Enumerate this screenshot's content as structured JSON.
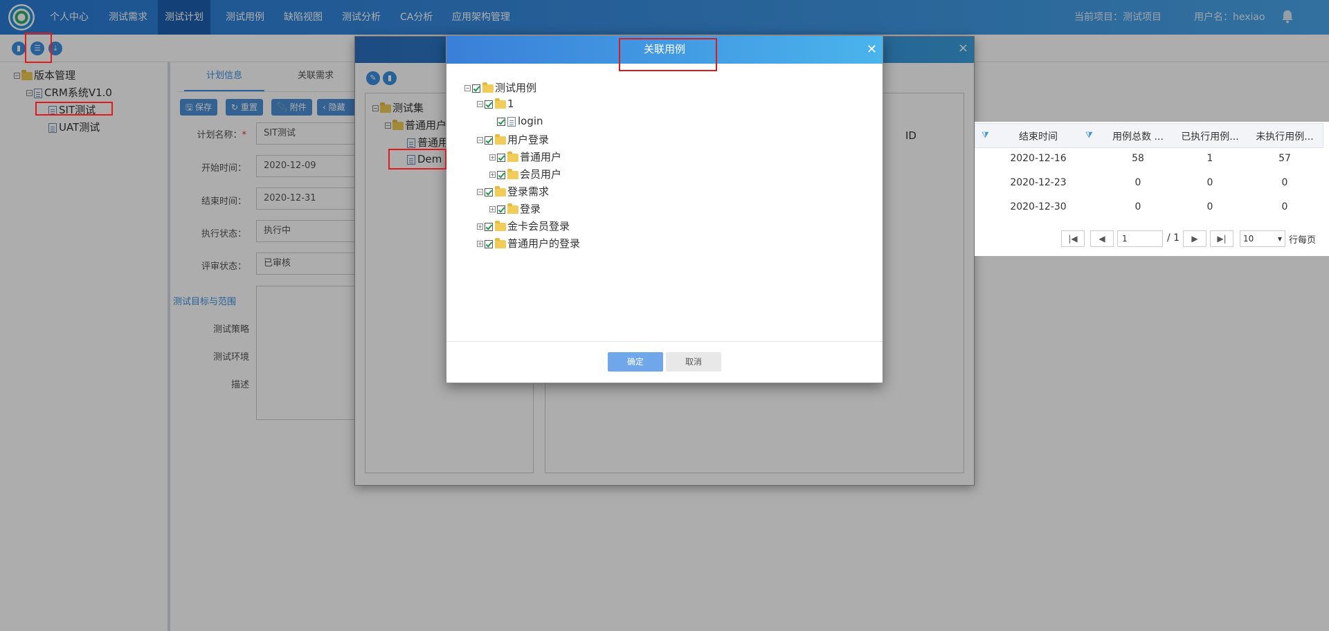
{
  "nav": {
    "items": [
      "个人中心",
      "测试需求",
      "测试计划",
      "测试用例",
      "缺陷视图",
      "测试分析",
      "CA分析",
      "应用架构管理"
    ],
    "active_index": 2,
    "current_project": "当前项目：测试项目",
    "username": "用户名：hexiao"
  },
  "left_tree": {
    "root": "版本管理",
    "version": "CRM系统V1.0",
    "plans": [
      "SIT测试",
      "UAT测试"
    ]
  },
  "tabs": [
    "计划信息",
    "关联需求"
  ],
  "buttons": {
    "save": "保存",
    "reset": "重置",
    "attach": "附件",
    "back": "隐藏"
  },
  "form": {
    "plan_name_label": "计划名称：",
    "plan_name": "SIT测试",
    "start_label": "开始时间：",
    "start": "2020-12-09",
    "end_label": "结束时间：",
    "end": "2020-12-31",
    "exec_label": "执行状态：",
    "exec": "执行中",
    "review_label": "评审状态：",
    "review": "已审核",
    "goal_label": "测试目标与范围",
    "strategy_label": "测试策略",
    "env_label": "测试环境",
    "desc_label": "描述"
  },
  "bg_dialog": {
    "tree_root": "测试集",
    "folder": "普通用户",
    "doc1": "普通用",
    "doc2": "Dem",
    "id_col": "ID"
  },
  "grid": {
    "headers": [
      "结束时间",
      "用例总数 ...",
      "已执行用例...",
      "未执行用例..."
    ],
    "rows": [
      [
        "2020-12-16",
        "58",
        "1",
        "57"
      ],
      [
        "2020-12-23",
        "0",
        "0",
        "0"
      ],
      [
        "2020-12-30",
        "0",
        "0",
        "0"
      ]
    ],
    "page_value": "1",
    "page_total": "/ 1",
    "page_size": "10",
    "per_page_label": "行每页"
  },
  "modal": {
    "title": "关联用例",
    "tree": [
      {
        "label": "测试用例",
        "type": "folder",
        "toggle": "−",
        "level": 0
      },
      {
        "label": "1",
        "type": "folder",
        "toggle": "−",
        "level": 1
      },
      {
        "label": "login",
        "type": "doc",
        "toggle": "",
        "level": 2
      },
      {
        "label": "用户登录",
        "type": "folder",
        "toggle": "−",
        "level": 1
      },
      {
        "label": "普通用户",
        "type": "folder",
        "toggle": "+",
        "level": 2
      },
      {
        "label": "会员用户",
        "type": "folder",
        "toggle": "+",
        "level": 2
      },
      {
        "label": "登录需求",
        "type": "folder",
        "toggle": "−",
        "level": 1
      },
      {
        "label": "登录",
        "type": "folder",
        "toggle": "+",
        "level": 2
      },
      {
        "label": "金卡会员登录",
        "type": "folder",
        "toggle": "+",
        "level": 1
      },
      {
        "label": "普通用户的登录",
        "type": "folder",
        "toggle": "+",
        "level": 1
      }
    ],
    "confirm": "确定",
    "cancel": "取消"
  },
  "colors": {
    "accent": "#3a8fe0",
    "annotation": "#e01a1a"
  }
}
